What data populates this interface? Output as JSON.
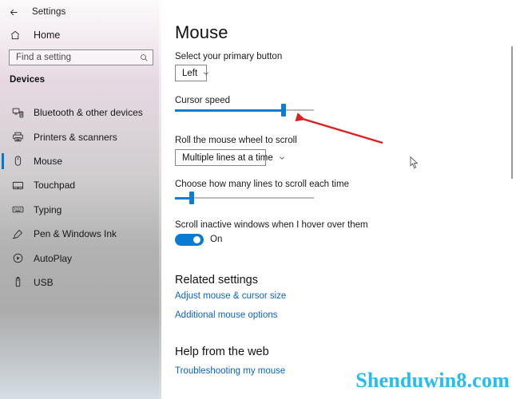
{
  "window": {
    "title": "Settings",
    "back_icon": "back-arrow-icon",
    "controls": {
      "minimize": "minimize-icon",
      "maximize": "maximize-icon",
      "close": "close-icon"
    }
  },
  "sidebar": {
    "home_label": "Home",
    "home_icon": "home-icon",
    "search": {
      "placeholder": "Find a setting",
      "value": "",
      "icon": "search-icon"
    },
    "section_header": "Devices",
    "items": [
      {
        "label": "Bluetooth & other devices",
        "icon": "bluetooth-devices-icon",
        "selected": false
      },
      {
        "label": "Printers & scanners",
        "icon": "printer-icon",
        "selected": false
      },
      {
        "label": "Mouse",
        "icon": "mouse-icon",
        "selected": true
      },
      {
        "label": "Touchpad",
        "icon": "touchpad-icon",
        "selected": false
      },
      {
        "label": "Typing",
        "icon": "keyboard-icon",
        "selected": false
      },
      {
        "label": "Pen & Windows Ink",
        "icon": "pen-icon",
        "selected": false
      },
      {
        "label": "AutoPlay",
        "icon": "autoplay-icon",
        "selected": false
      },
      {
        "label": "USB",
        "icon": "usb-icon",
        "selected": false
      }
    ]
  },
  "main": {
    "page_title": "Mouse",
    "primary_button": {
      "label": "Select your primary button",
      "value": "Left",
      "chevron_icon": "chevron-down-icon"
    },
    "cursor_speed": {
      "label": "Cursor speed",
      "percent": 78
    },
    "wheel_scroll": {
      "label": "Roll the mouse wheel to scroll",
      "value": "Multiple lines at a time",
      "chevron_icon": "chevron-down-icon"
    },
    "lines_to_scroll": {
      "label": "Choose how many lines to scroll each time",
      "percent": 12
    },
    "inactive_scroll": {
      "label": "Scroll inactive windows when I hover over them",
      "state": "On"
    },
    "related_settings": {
      "header": "Related settings",
      "links": [
        "Adjust mouse & cursor size",
        "Additional mouse options"
      ]
    },
    "help": {
      "header": "Help from the web",
      "links": [
        "Troubleshooting my mouse"
      ]
    }
  },
  "annotation": {
    "arrow_color": "#e02020",
    "arrow_name": "red-arrow-pointing-at-cursor-speed-slider"
  },
  "watermark": {
    "text": "Shenduwin8.com",
    "color": "#28bdf0"
  },
  "colors": {
    "accent": "#0078d4",
    "link": "#0a63c9"
  }
}
